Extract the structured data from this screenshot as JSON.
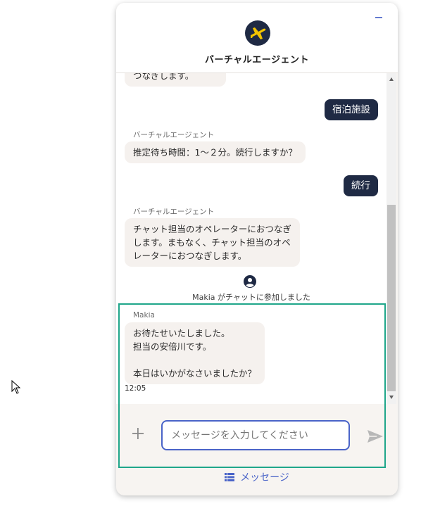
{
  "header": {
    "title": "バーチャルエージェント",
    "logo_icon": "airplane-logo-icon",
    "minimize_icon": "minimize-icon",
    "accent_color": "#4a64c8",
    "logo_color": "#1f2a44",
    "logo_plane_color": "#f3c400"
  },
  "transcript": {
    "messages": [
      {
        "type": "agent",
        "text": "つなぎします。"
      },
      {
        "type": "user",
        "text": "宿泊施設"
      },
      {
        "type": "agent",
        "sender": "バーチャルエージェント",
        "text": "推定待ち時間：1～２分。続行しますか？"
      },
      {
        "type": "user",
        "text": "続行"
      },
      {
        "type": "agent",
        "sender": "バーチャルエージェント",
        "lines": [
          "チャット担当のオペレーターにおつなぎ",
          "します。まもなく、チャット担当のオペ",
          "レーターにおつなぎします。"
        ]
      },
      {
        "type": "system",
        "text": "Makia がチャットに参加しました"
      },
      {
        "type": "agent",
        "sender": "Makia",
        "lines": [
          "お待たせいたしました。",
          "担当の安倍川です。",
          "",
          "本日はいかがなさいましたか？"
        ],
        "time": "12:05"
      }
    ]
  },
  "composer": {
    "placeholder": "メッセージを入力してください",
    "plus_icon": "plus-icon",
    "send_icon": "send-icon"
  },
  "footer": {
    "label": "メッセージ",
    "icon": "list-icon"
  },
  "colors": {
    "user_bubble": "#1f2a44",
    "agent_bubble": "#f5f1ee",
    "highlight_border": "#1fa68a"
  }
}
